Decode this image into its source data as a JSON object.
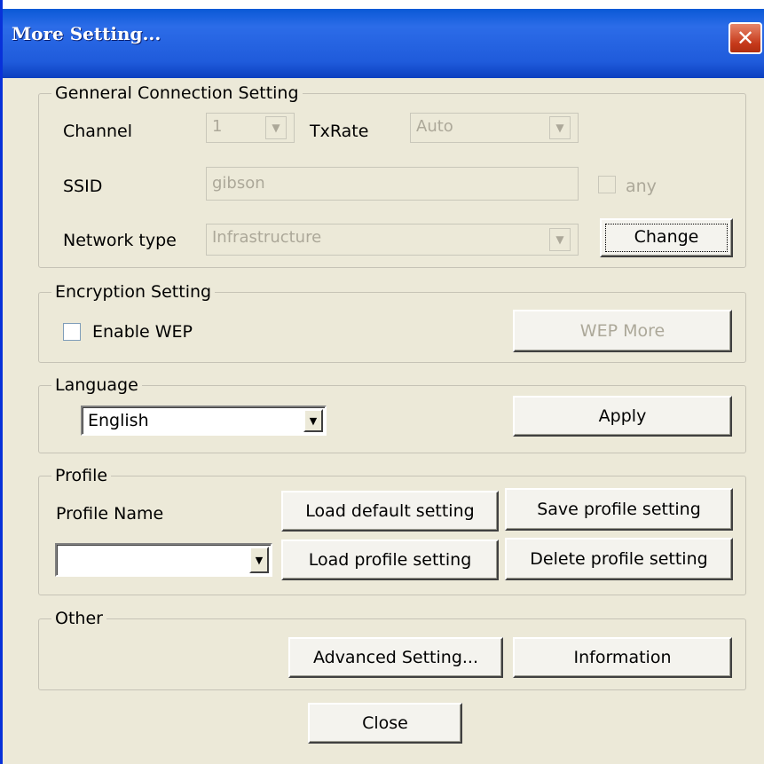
{
  "window": {
    "title": "More Setting...",
    "close_glyph": "✕"
  },
  "general": {
    "legend": "Genneral Connection Setting",
    "channel_label": "Channel",
    "channel_value": "1",
    "txrate_label": "TxRate",
    "txrate_value": "Auto",
    "ssid_label": "SSID",
    "ssid_value": "gibson",
    "any_label": "any",
    "network_type_label": "Network type",
    "network_type_value": "Infrastructure",
    "change_button": "Change"
  },
  "encryption": {
    "legend": "Encryption Setting",
    "enable_wep_label": "Enable WEP",
    "wep_more_button": "WEP More"
  },
  "language": {
    "legend": "Language",
    "selected": "English",
    "apply_button": "Apply"
  },
  "profile": {
    "legend": "Profile",
    "name_label": "Profile Name",
    "selected": "",
    "load_default_button": "Load default setting",
    "save_profile_button": "Save profile setting",
    "load_profile_button": "Load profile setting",
    "delete_profile_button": "Delete profile setting"
  },
  "other": {
    "legend": "Other",
    "advanced_button": "Advanced Setting...",
    "information_button": "Information"
  },
  "close_button": "Close",
  "icons": {
    "dropdown": "chevron-down-icon",
    "close": "close-icon"
  }
}
